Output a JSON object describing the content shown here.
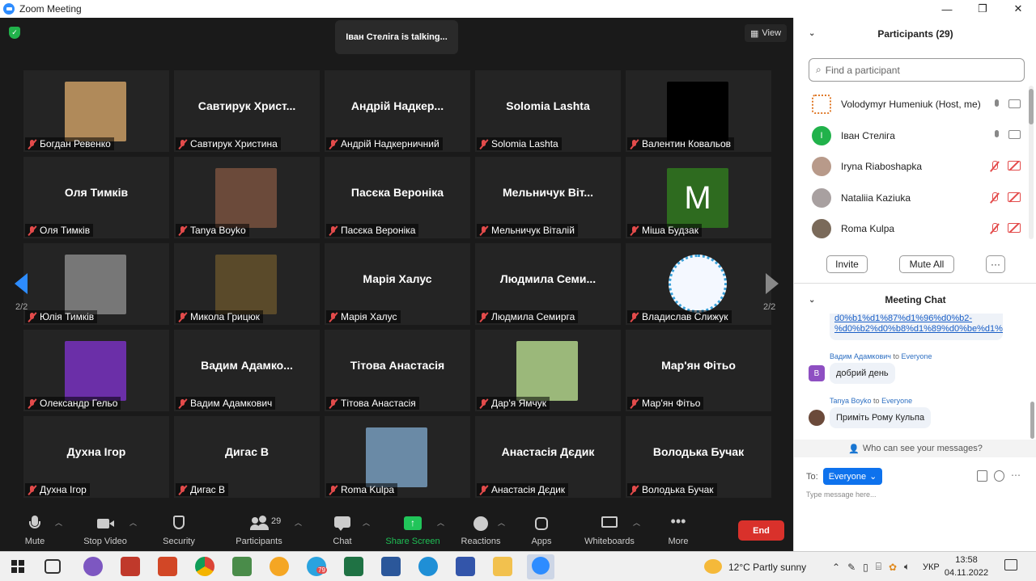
{
  "window": {
    "title": "Zoom Meeting",
    "min": "—",
    "max": "❐",
    "close": "✕"
  },
  "video": {
    "talking": "Іван Стеліга is talking...",
    "view_label": "View",
    "page_left": "2/2",
    "page_right": "2/2",
    "tiles": [
      {
        "big": "",
        "label": "Богдан Ревенко",
        "pic": "#b08a5a"
      },
      {
        "big": "Савтирук  Христ...",
        "label": "Савтирук Христина"
      },
      {
        "big": "Андрій  Надкер...",
        "label": "Андрій Надкерничний"
      },
      {
        "big": "Solomia Lashta",
        "label": "Solomia Lashta"
      },
      {
        "big": "",
        "label": "Валентин Ковальов",
        "pic": "#000000"
      },
      {
        "big": "Оля Тимків",
        "label": "Оля Тимків"
      },
      {
        "big": "",
        "label": "Tanya Boyko",
        "pic": "#6b4a3a"
      },
      {
        "big": "Пасєка Вероніка",
        "label": "Пасєка Вероніка"
      },
      {
        "big": "Мельничук  Віт...",
        "label": "Мельничук Віталій"
      },
      {
        "big": "",
        "label": "Міша Будзак",
        "pic": "#2e6b1f",
        "letter": "M"
      },
      {
        "big": "",
        "label": "Юлія Тимків",
        "pic": "#777777"
      },
      {
        "big": "",
        "label": "Микола Грицюк",
        "pic": "#5a4a2a"
      },
      {
        "big": "Марія Халус",
        "label": "Марія Халус"
      },
      {
        "big": "Людмила  Семи...",
        "label": "Людмила Семирга"
      },
      {
        "big": "",
        "label": "Владислав Слижук",
        "pic": "#f4f8ff",
        "ring": true
      },
      {
        "big": "",
        "label": "Олександр Гельо",
        "pic": "#6b2fa8"
      },
      {
        "big": "Вадим  Адамко...",
        "label": "Вадим Адамкович"
      },
      {
        "big": "Тітова Анастасія",
        "label": "Тітова Анастасія"
      },
      {
        "big": "",
        "label": "Дар'я Ямчук",
        "pic": "#9bb87a"
      },
      {
        "big": "Мар'ян Фітьо",
        "label": "Мар'ян Фітьо"
      },
      {
        "big": "Духна Ігор",
        "label": "Духна Ігор"
      },
      {
        "big": "Дигас В",
        "label": "Дигас В"
      },
      {
        "big": "",
        "label": "Roma Kulpa",
        "pic": "#6a8aa6"
      },
      {
        "big": "Анастасія Дєдик",
        "label": "Анастасія Дєдик"
      },
      {
        "big": "Володька Бучак",
        "label": "Володька Бучак"
      }
    ]
  },
  "toolbar": {
    "mute": "Mute",
    "stop_video": "Stop Video",
    "security": "Security",
    "participants": "Participants",
    "participants_count": "29",
    "chat": "Chat",
    "share": "Share Screen",
    "reactions": "Reactions",
    "apps": "Apps",
    "whiteboards": "Whiteboards",
    "more": "More",
    "end": "End"
  },
  "participants": {
    "title": "Participants (29)",
    "search_placeholder": "Find a participant",
    "list": [
      {
        "name": "Volodymyr Humeniuk (Host, me)",
        "muted": false
      },
      {
        "name": "Іван Стеліга",
        "muted": false,
        "initial": "I"
      },
      {
        "name": "Iryna Riaboshapka",
        "muted": true
      },
      {
        "name": "Nataliia Kaziuka",
        "muted": true
      },
      {
        "name": "Roma Kulpa",
        "muted": true
      }
    ],
    "invite": "Invite",
    "mute_all": "Mute All",
    "more": "···"
  },
  "chat": {
    "title": "Meeting Chat",
    "link_text": "d0%b1%d1%87%d1%96%d0%b2-%d0%b2%d0%b8%d1%89%d0%be%d1%97/",
    "messages": [
      {
        "from": "Вадим Адамкович",
        "to_word": "to",
        "to": "Everyone",
        "text": "добрий день",
        "initial": "В"
      },
      {
        "from": "Tanya Boyko",
        "to_word": "to",
        "to": "Everyone",
        "text": "Приміть Рому Кульпа"
      }
    ],
    "who_can_see": "Who can see your messages?",
    "to_label": "To:",
    "to_value": "Everyone",
    "placeholder": "Type message here..."
  },
  "taskbar": {
    "weather": "12°C  Partly sunny",
    "lang": "УКР",
    "time": "13:58",
    "date": "04.11.2022",
    "telegram_badge": "79"
  }
}
